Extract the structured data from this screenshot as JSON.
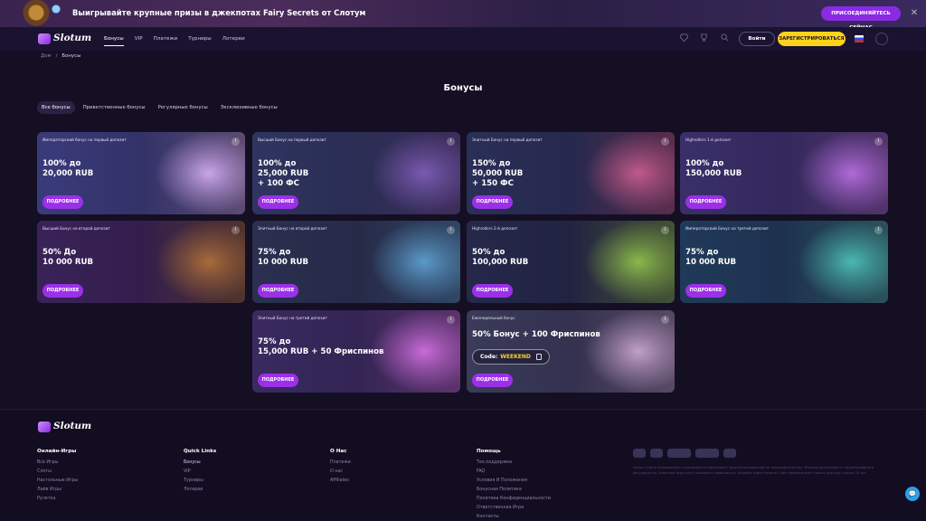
{
  "promo": {
    "text": "Выигрывайте крупные призы в джекпотах Fairy Secrets от Слотум",
    "button": "ПРИСОЕДИНЯЙТЕСЬ СЕЙЧАС",
    "close": "✕"
  },
  "header": {
    "logo": "Slotum",
    "nav": [
      "Бонусы",
      "VIP",
      "Платежи",
      "Турниры",
      "Лотереи"
    ],
    "login": "Войти",
    "register": "ЗАРЕГИСТРИРОВАТЬСЯ"
  },
  "breadcrumb": {
    "home": "Дом",
    "separator": "/",
    "current": "Бонусы"
  },
  "page": {
    "title": "Бонусы",
    "tabs": [
      "Все бонусы",
      "Приветственные бонусы",
      "Регулярные бонусы",
      "Эксклюзивные бонусы"
    ]
  },
  "cards": [
    {
      "title": "Императорский бонус на первый депозит",
      "offer": "100% до\n20,000 RUB",
      "button": "ПОДРОБНЕЕ",
      "bg": "#3a3b7a",
      "art": "#c9a5e8"
    },
    {
      "title": "Высший Бонус на первый депозит",
      "offer": "100% до\n25,000 RUB\n+ 100 ФС",
      "button": "ПОДРОБНЕЕ",
      "bg": "#2f3560",
      "art": "#7a5ab0"
    },
    {
      "title": "Элитный Бонус на первый депозит",
      "offer": "150% до\n50,000 RUB\n+ 150 ФС",
      "button": "ПОДРОБНЕЕ",
      "bg": "#2a2f58",
      "art": "#c05a8a"
    },
    {
      "title": "Highrollers 1-й депозит",
      "offer": "100% до\n150,000 RUB",
      "button": "ПОДРОБНЕЕ",
      "bg": "#3a2f6a",
      "art": "#b06ad8"
    },
    {
      "title": "Высший Бонус на второй депозит",
      "offer": "50% До\n10 000 RUB",
      "button": "ПОДРОБНЕЕ",
      "bg": "#3a2258",
      "art": "#a86a3a"
    },
    {
      "title": "Элитный Бонус на второй депозит",
      "offer": "75% до\n10 000 RUB",
      "button": "ПОДРОБНЕЕ",
      "bg": "#2b3050",
      "art": "#5a9ac8"
    },
    {
      "title": "Highrollers 2-й депозит",
      "offer": "50% до\n100,000 RUB",
      "button": "ПОДРОБНЕЕ",
      "bg": "#25284a",
      "art": "#8ab84a"
    },
    {
      "title": "Императорский Бонус на третий депозит",
      "offer": "75% до\n10 000 RUB",
      "button": "ПОДРОБНЕЕ",
      "bg": "#203a5a",
      "art": "#4ab8b0"
    },
    {
      "title": "Элитный Бонус на третий депозит",
      "offer": "75% до\n15,000 RUB + 50 Фриспинов",
      "button": "ПОДРОБНЕЕ",
      "bg": "#3a2a60",
      "art": "#c86ad8"
    },
    {
      "title": "Еженедельный бонус",
      "offer": "50% Бонус + 100 Фриспинов",
      "button": "ПОДРОБНЕЕ",
      "bg": "#3a3a5a",
      "art": "#c0a0c8",
      "code_label": "Code:",
      "code_value": "WEEKEND"
    }
  ],
  "footer": {
    "logo": "Slotum",
    "columns": [
      {
        "head": "Онлайн-Игры",
        "links": [
          "Все Игры",
          "Слоты",
          "Настольные Игры",
          "Лайв Игры",
          "Рулетка"
        ]
      },
      {
        "head": "Quick Links",
        "links": [
          "Бонусы",
          "VIP",
          "Турниры",
          "Лотереи"
        ]
      },
      {
        "head": "О Нас",
        "links": [
          "Платежи",
          "О нас",
          "Affiliates"
        ]
      },
      {
        "head": "Помощь",
        "links": [
          "Тех.поддержка",
          "FAQ",
          "Условия И Положения",
          "Бонусная Политика",
          "Политика Конфиденциальности",
          "Ответственная Игра",
          "Контакты"
        ]
      }
    ],
    "legal": "Slotum Casino принадлежит и управляется компанией, зарегистрированной по законодательству. Игровая деятельность лицензирована и регулируется. Азартные игры могут вызывать зависимость. Играйте ответственно. Сайт предназначен только для лиц старше 18 лет.",
    "chat": "💬"
  },
  "icons": {
    "promo_close": "close-icon",
    "header_icons": [
      "diamond-icon",
      "trophy-icon",
      "search-icon"
    ],
    "card_info": "info-icon",
    "copy": "copy-icon",
    "chat": "chat-icon"
  },
  "colors": {
    "accent": "#9b30e8",
    "register": "#ffd21a",
    "background": "#150f24",
    "code": "#ffd21a"
  }
}
